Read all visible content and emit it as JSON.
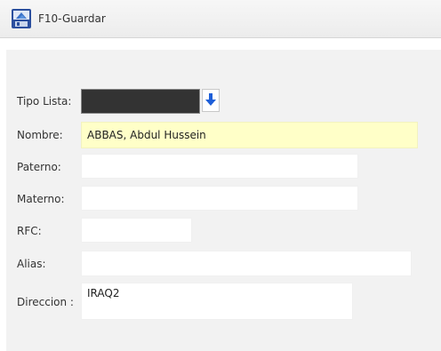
{
  "toolbar": {
    "save_label": "F10-Guardar",
    "save_icon": "save-disk-icon"
  },
  "form": {
    "tipo_lista": {
      "label": "Tipo Lista:",
      "value": "",
      "dropdown_icon": "arrow-down-icon"
    },
    "nombre": {
      "label": "Nombre:",
      "value": "ABBAS, Abdul Hussein"
    },
    "paterno": {
      "label": "Paterno:",
      "value": ""
    },
    "materno": {
      "label": "Materno:",
      "value": ""
    },
    "rfc": {
      "label": "RFC:",
      "value": ""
    },
    "alias": {
      "label": "Alias:",
      "value": ""
    },
    "direccion": {
      "label": "Direccion :",
      "value": "IRAQ2"
    }
  },
  "colors": {
    "highlight_field": "#ffffc8",
    "dropdown_arrow": "#1e5fd8"
  }
}
